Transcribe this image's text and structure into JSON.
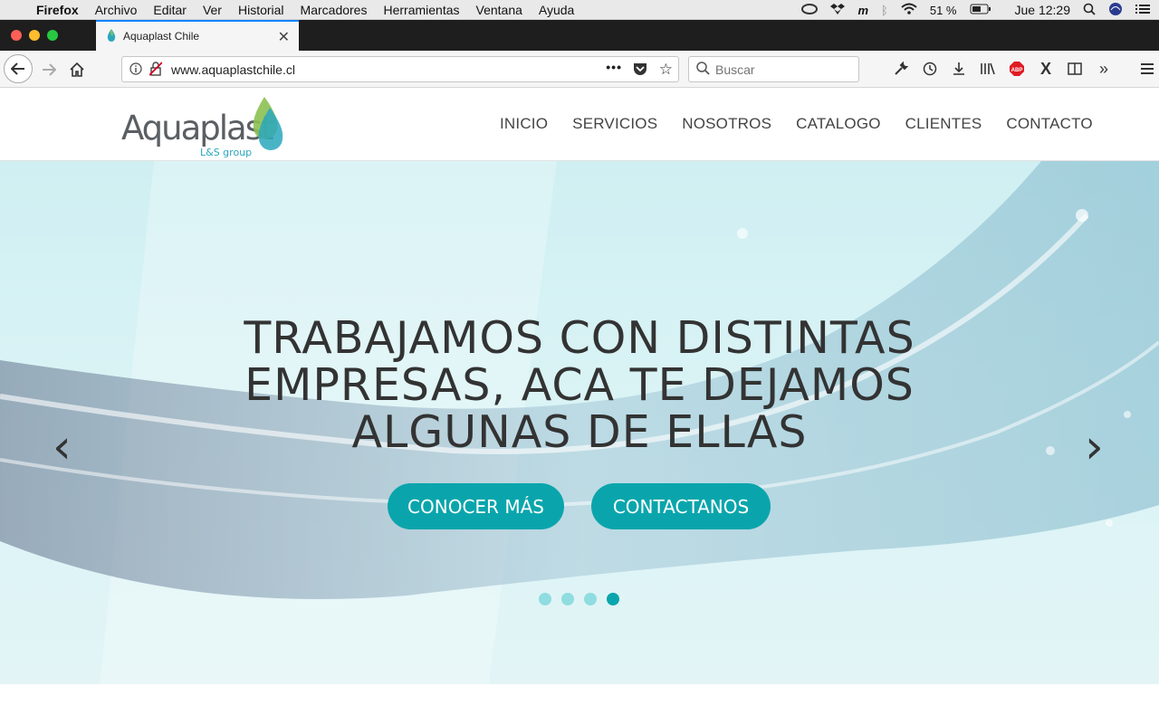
{
  "macos_menubar": {
    "apple": "",
    "items": [
      "Firefox",
      "Archivo",
      "Editar",
      "Ver",
      "Historial",
      "Marcadores",
      "Herramientas",
      "Ventana",
      "Ayuda"
    ],
    "battery": "51 %",
    "clock": "Jue 12:29"
  },
  "browser": {
    "tab_title": "Aquaplast Chile",
    "url": "www.aquaplastchile.cl",
    "search_placeholder": "Buscar",
    "accent_color": "#0a84ff"
  },
  "site": {
    "logo_name": "Aquaplast",
    "logo_sub": "L&S group",
    "nav": [
      "INICIO",
      "SERVICIOS",
      "NOSOTROS",
      "CATALOGO",
      "CLIENTES",
      "CONTACTO"
    ],
    "hero": {
      "headline": "TRABAJAMOS CON DISTINTAS EMPRESAS, ACA TE DEJAMOS ALGUNAS DE ELLAS",
      "button_1": "CONOCER MÁS",
      "button_2": "CONTACTANOS",
      "prev": "‹",
      "next": "›",
      "slide_count": 4,
      "active_slide": 4,
      "accent_color": "#0aa5ac"
    }
  }
}
